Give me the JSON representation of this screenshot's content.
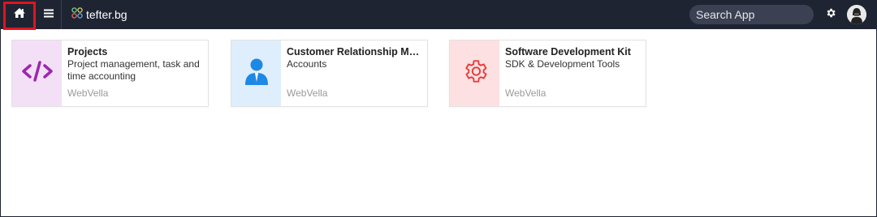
{
  "header": {
    "brand": "tefter.bg",
    "search_placeholder": "Search App",
    "icons": {
      "home": "home-icon",
      "menu": "hamburger-menu-icon",
      "logo": "four-circles-logo-icon",
      "settings": "gear-icon",
      "avatar": "user-avatar"
    }
  },
  "apps": [
    {
      "title": "Projects",
      "description": "Project management, task and time accounting",
      "author": "WebVella",
      "icon": "code-icon",
      "icon_color": "#9c27b0",
      "panel_color": "#f3e0f6"
    },
    {
      "title": "Customer Relationship Ma...",
      "description": "Accounts",
      "author": "WebVella",
      "icon": "user-icon",
      "icon_color": "#1e88e5",
      "panel_color": "#deeefc"
    },
    {
      "title": "Software Development Kit",
      "description": "SDK & Development Tools",
      "author": "WebVella",
      "icon": "gear-icon",
      "icon_color": "#e53935",
      "panel_color": "#fce0e2"
    }
  ],
  "colors": {
    "topbar": "#1f2433",
    "highlight": "#e0141e"
  }
}
